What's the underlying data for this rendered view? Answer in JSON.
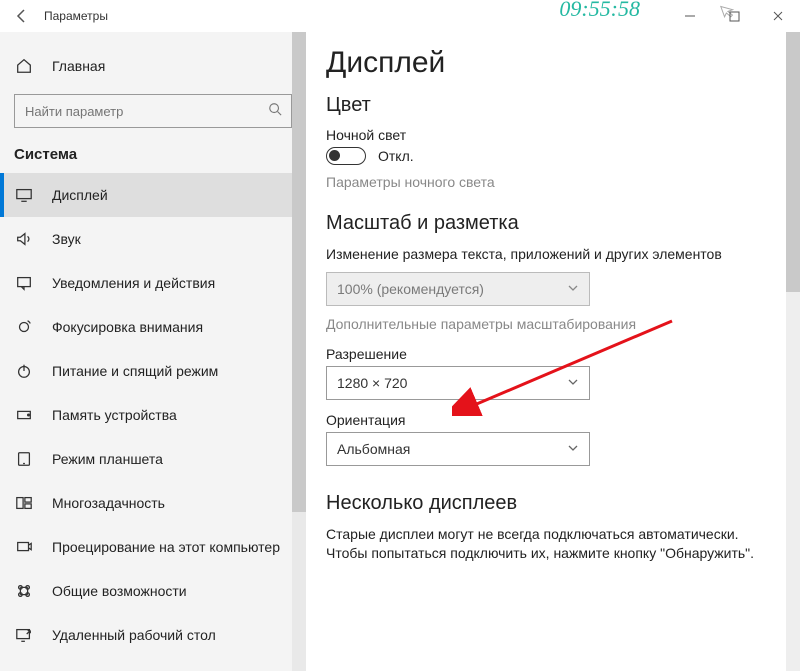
{
  "titlebar": {
    "app_title": "Параметры",
    "clock": "09:55:58"
  },
  "sidebar": {
    "home_label": "Главная",
    "search_placeholder": "Найти параметр",
    "section_label": "Система",
    "items": [
      {
        "label": "Дисплей"
      },
      {
        "label": "Звук"
      },
      {
        "label": "Уведомления и действия"
      },
      {
        "label": "Фокусировка внимания"
      },
      {
        "label": "Питание и спящий режим"
      },
      {
        "label": "Память устройства"
      },
      {
        "label": "Режим планшета"
      },
      {
        "label": "Многозадачность"
      },
      {
        "label": "Проецирование на этот компьютер"
      },
      {
        "label": "Общие возможности"
      },
      {
        "label": "Удаленный рабочий стол"
      }
    ]
  },
  "content": {
    "page_title": "Дисплей",
    "color_section": "Цвет",
    "night_light_label": "Ночной свет",
    "toggle_off": "Откл.",
    "night_light_settings": "Параметры ночного света",
    "scale_section": "Масштаб и разметка",
    "scale_label": "Изменение размера текста, приложений и других элементов",
    "scale_value": "100% (рекомендуется)",
    "advanced_scale": "Дополнительные параметры масштабирования",
    "resolution_label": "Разрешение",
    "resolution_value": "1280 × 720",
    "orientation_label": "Ориентация",
    "orientation_value": "Альбомная",
    "multi_section": "Несколько дисплеев",
    "multi_text": "Старые дисплеи могут не всегда подключаться автоматически. Чтобы попытаться подключить их, нажмите кнопку \"Обнаружить\"."
  }
}
